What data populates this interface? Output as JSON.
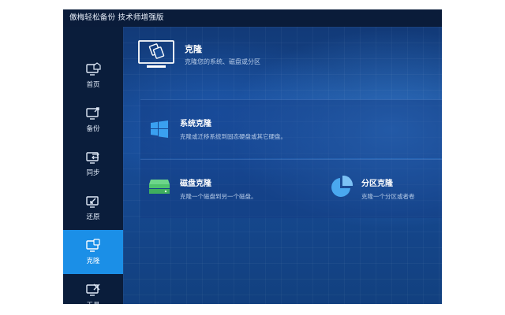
{
  "app": {
    "title": "傲梅轻松备份 技术师增强版"
  },
  "sidebar": {
    "items": [
      {
        "label": "首页",
        "icon": "home-icon",
        "active": false
      },
      {
        "label": "备份",
        "icon": "backup-icon",
        "active": false
      },
      {
        "label": "同步",
        "icon": "sync-icon",
        "active": false
      },
      {
        "label": "还原",
        "icon": "restore-icon",
        "active": false
      },
      {
        "label": "克隆",
        "icon": "clone-icon",
        "active": true
      },
      {
        "label": "工具",
        "icon": "tools-icon",
        "active": false
      }
    ]
  },
  "header": {
    "title": "克隆",
    "subtitle": "克隆您的系统、磁盘或分区"
  },
  "options": {
    "system": {
      "title": "系统克隆",
      "desc": "克隆或迁移系统到固态硬盘或其它硬盘。"
    },
    "disk": {
      "title": "磁盘克隆",
      "desc": "克隆一个磁盘到另一个磁盘。"
    },
    "partition": {
      "title": "分区克隆",
      "desc": "克隆一个分区或者卷"
    }
  },
  "colors": {
    "accent": "#1b8fe7",
    "sidebar_bg": "#0a1d3b",
    "windows_blue": "#3aa0f0",
    "disk_green": "#4fc46e",
    "pie_blue": "#4aa8ef"
  }
}
